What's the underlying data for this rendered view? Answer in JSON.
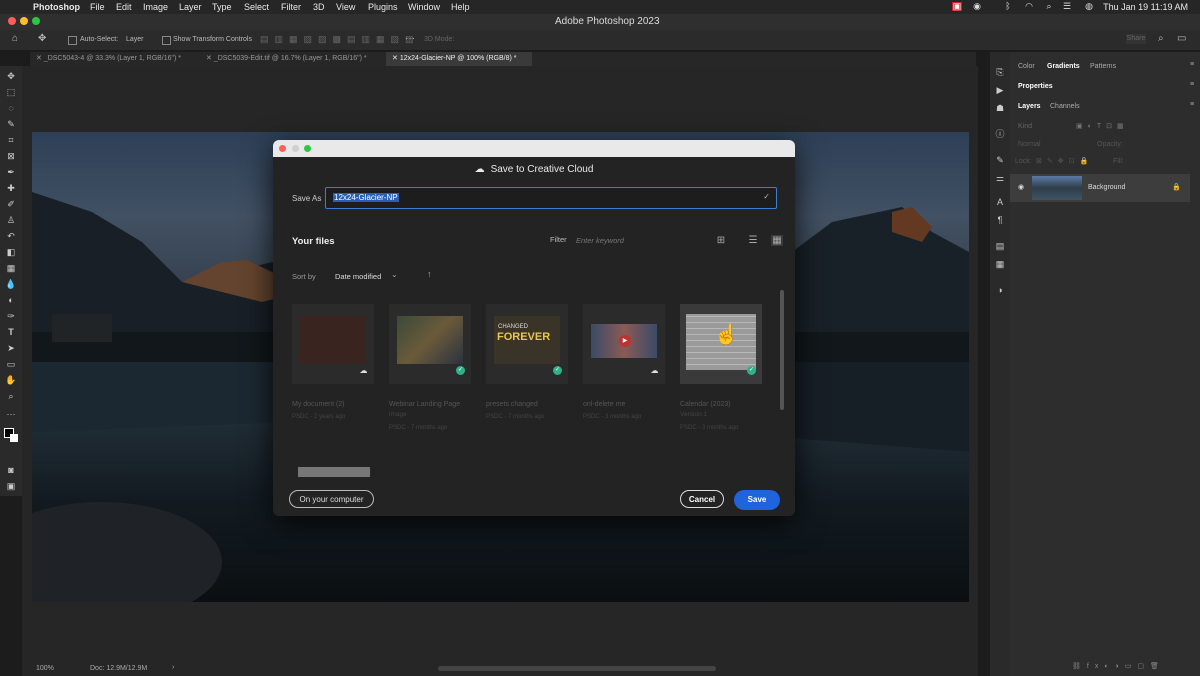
{
  "menubar": {
    "app": "Photoshop",
    "items": [
      "File",
      "Edit",
      "Image",
      "Layer",
      "Type",
      "Select",
      "Filter",
      "3D",
      "View",
      "Plugins",
      "Window",
      "Help"
    ],
    "clock": "Thu Jan 19  11:19 AM"
  },
  "window": {
    "title": "Adobe Photoshop 2023"
  },
  "options": {
    "auto_select_label": "Auto-Select:",
    "auto_select_value": "Layer",
    "transform_label": "Show Transform Controls",
    "mode_3d": "3D Mode:",
    "share_label": "Share"
  },
  "tabs": [
    {
      "label": "_DSC5043-4 @ 33.3% (Layer 1, RGB/16\") *"
    },
    {
      "label": "_DSC5039-Edit.tif @ 16.7% (Layer 1, RGB/16\") *"
    },
    {
      "label": "12x24-Glacier-NP @ 100% (RGB/8) *"
    }
  ],
  "status": {
    "zoom": "100%",
    "doc": "Doc: 12.9M/12.9M"
  },
  "right_panel": {
    "tabs1": [
      "Color",
      "Gradients",
      "Patterns"
    ],
    "properties": "Properties",
    "tabs2": [
      "Layers",
      "Channels"
    ],
    "kind_placeholder": "Kind",
    "blend": "Normal",
    "opacity": "Opacity:",
    "lock": "Lock:",
    "fill": "Fill:",
    "layer_name": "Background"
  },
  "dialog": {
    "title": "Save to Creative Cloud",
    "save_as_label": "Save As",
    "save_as_value": "12x24-Glacier-NP",
    "your_files": "Your files",
    "filter_label": "Filter",
    "filter_placeholder": "Enter keyword",
    "sort_by_label": "Sort by",
    "sort_value": "Date modified",
    "files": [
      {
        "name": "My document (2)",
        "name2": "",
        "meta": "PSDC - 2 years ago",
        "status": "cloud"
      },
      {
        "name": "Webinar Landing Page",
        "name2": "image",
        "meta": "PSDC - 7 months ago",
        "status": "synced"
      },
      {
        "name": "presets changed",
        "name2": "",
        "meta": "PSDC - 7 months ago",
        "status": "synced"
      },
      {
        "name": "onl-delete me",
        "name2": "",
        "meta": "PSDC - 3 months ago",
        "status": "cloud"
      },
      {
        "name": "Calendar (2023)",
        "name2": "Version 1",
        "meta": "PSDC - 3 months ago",
        "status": "synced"
      }
    ],
    "thumb_text": {
      "changed": "CHANGED",
      "forever": "FOREVER"
    },
    "on_computer": "On your computer",
    "cancel": "Cancel",
    "save": "Save"
  },
  "colors": {
    "save_blue": "#1f63dd",
    "accent_green": "#2db289"
  }
}
